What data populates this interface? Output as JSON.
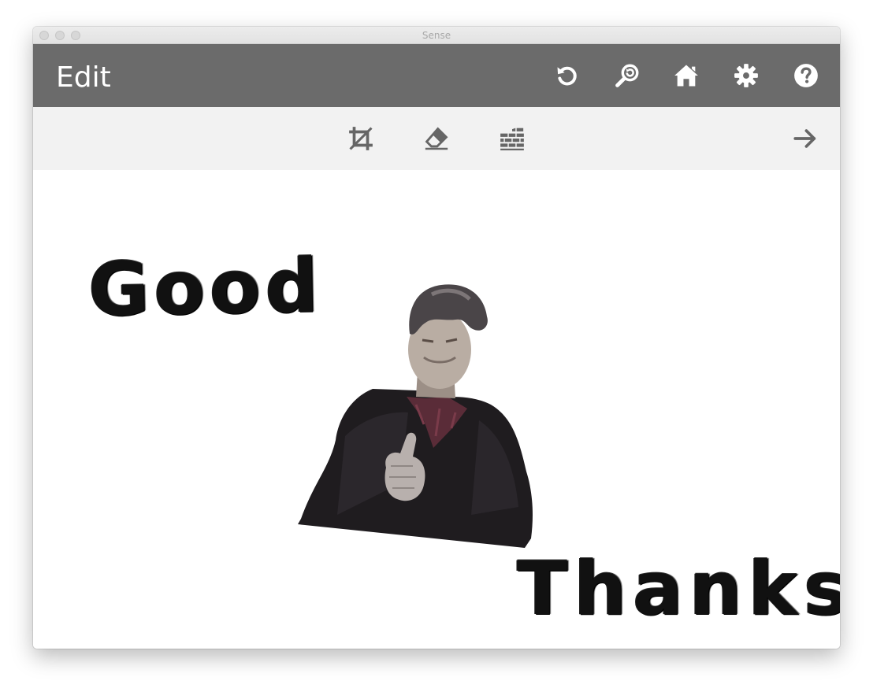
{
  "window": {
    "title": "Sense"
  },
  "appbar": {
    "title": "Edit",
    "actions": [
      {
        "name": "undo",
        "icon": "undo-icon"
      },
      {
        "name": "zoom-reset",
        "icon": "zoom-reset-icon"
      },
      {
        "name": "home",
        "icon": "home-icon"
      },
      {
        "name": "settings",
        "icon": "gear-icon"
      },
      {
        "name": "help",
        "icon": "help-icon"
      }
    ]
  },
  "toolbar": {
    "tools": [
      {
        "name": "crop",
        "icon": "crop-icon"
      },
      {
        "name": "eraser",
        "icon": "eraser-icon"
      },
      {
        "name": "background",
        "icon": "brick-wall-icon"
      }
    ],
    "next": {
      "icon": "arrow-right-icon"
    }
  },
  "canvas": {
    "stickers": [
      {
        "text": "Good"
      },
      {
        "text": "Thanks"
      }
    ]
  },
  "colors": {
    "appbar": "#6b6b6b",
    "toolbar": "#f2f2f2",
    "icon_light": "#ffffff",
    "icon_dark": "#666666"
  }
}
